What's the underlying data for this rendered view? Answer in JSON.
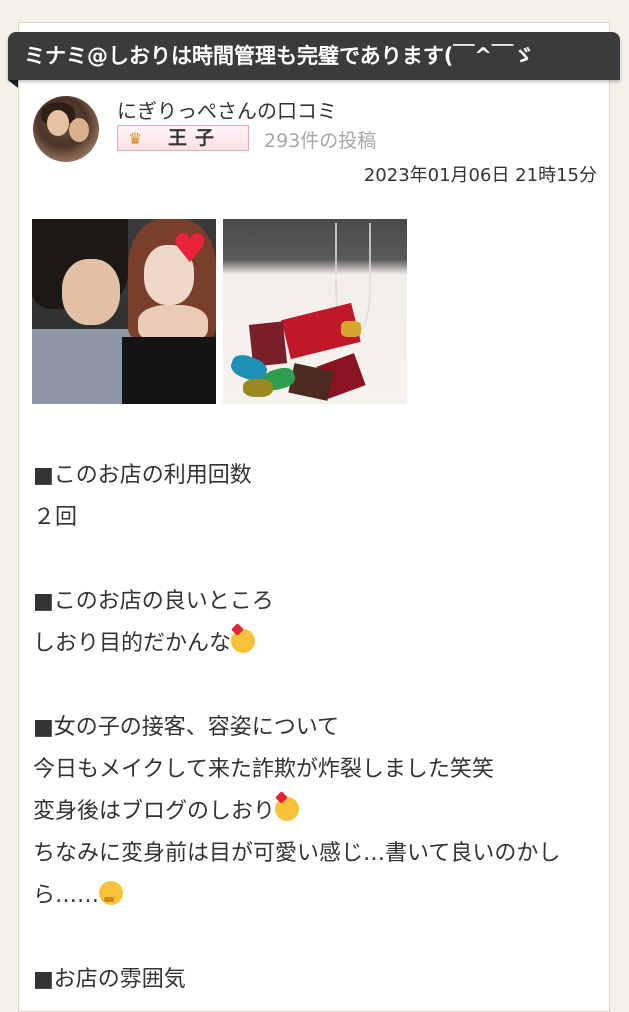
{
  "review_title": "ミナミ@しおりは時間管理も完璧であります(￣^￣ゞ",
  "reviewer": {
    "name": "にぎりっぺさんの口コミ",
    "rank": "王子",
    "post_count": "293件の投稿",
    "avatar": "reviewer-avatar"
  },
  "post_date": "2023年01月06日 21時15分",
  "photos": [
    {
      "name": "photo-couple-selfie"
    },
    {
      "name": "photo-chocolates-champagne"
    }
  ],
  "sections": {
    "visits_heading": "■このお店の利用回数",
    "visits_value": "２回",
    "good_heading": "■このお店の良いところ",
    "good_value": "しおり目的だかんな",
    "girl_heading": "■女の子の接客、容姿について",
    "girl_line1": "今日もメイクして来た詐欺が炸裂しました笑笑",
    "girl_line2": "変身後はブログのしおり",
    "girl_line3": "ちなみに変身前は目が可愛い感じ…書いて良いのかし",
    "girl_line4": "ら……",
    "atmos_heading": "■お店の雰囲気"
  },
  "colors": {
    "banner_bg": "#3b3b3b",
    "rank_badge_bg": "#ffdfe6",
    "post_count": "#a7a7a7"
  }
}
